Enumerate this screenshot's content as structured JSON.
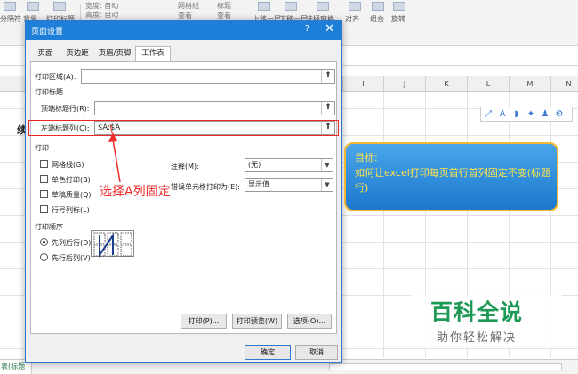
{
  "ribbon": {
    "items": [
      "分隔符",
      "背景",
      "打印标题",
      "宽度: 自动",
      "高度: 自动",
      "网格线",
      "标题",
      "查看",
      "查看",
      "上移一层",
      "下移一层",
      "选择窗格",
      "对齐",
      "组合",
      "旋转"
    ]
  },
  "columns": [
    "I",
    "J",
    "K",
    "L",
    "M",
    "N"
  ],
  "cell_text": "续",
  "sheet_tab": "表(标题",
  "dialog": {
    "title": "页面设置",
    "help": "?",
    "close": "✕",
    "tabs": [
      "页面",
      "页边距",
      "页眉/页脚",
      "工作表"
    ],
    "print_area_label": "打印区域(A):",
    "print_area_value": "",
    "print_titles_section": "打印标题",
    "rows_repeat_label": "顶端标题行(R):",
    "rows_repeat_value": "",
    "cols_repeat_label": "左端标题列(C):",
    "cols_repeat_value": "$A:$A",
    "print_section": "打印",
    "gridlines_label": "网格线(G)",
    "bw_label": "单色打印(B)",
    "draft_label": "草稿质量(Q)",
    "headings_label": "行号列标(L)",
    "comments_label": "注释(M):",
    "comments_value": "(无)",
    "errors_label": "错误单元格打印为(E):",
    "errors_value": "显示值",
    "order_section": "打印顺序",
    "down_then_over_label": "先列后行(D)",
    "over_then_down_label": "先行后列(V)",
    "print_button": "打印(P)...",
    "preview_button": "打印预览(W)",
    "options_button": "选项(O)...",
    "ok_button": "确定",
    "cancel_button": "取消"
  },
  "annotation": {
    "text": "选择A列固定"
  },
  "goal": {
    "title": "目标:",
    "body": "如何让excel打印每页首行首列固定不变(标题行)"
  },
  "watermark": {
    "main": "百科全说",
    "sub": "助你轻松解决"
  },
  "colors": {
    "dialog_title_bg": "#1e7fd8",
    "highlight_red": "#e8282a",
    "goal_box_bg": "#2e8fe0",
    "goal_box_border": "#f5b731",
    "goal_text": "#ffe34a",
    "watermark_green": "#1e9a56"
  }
}
